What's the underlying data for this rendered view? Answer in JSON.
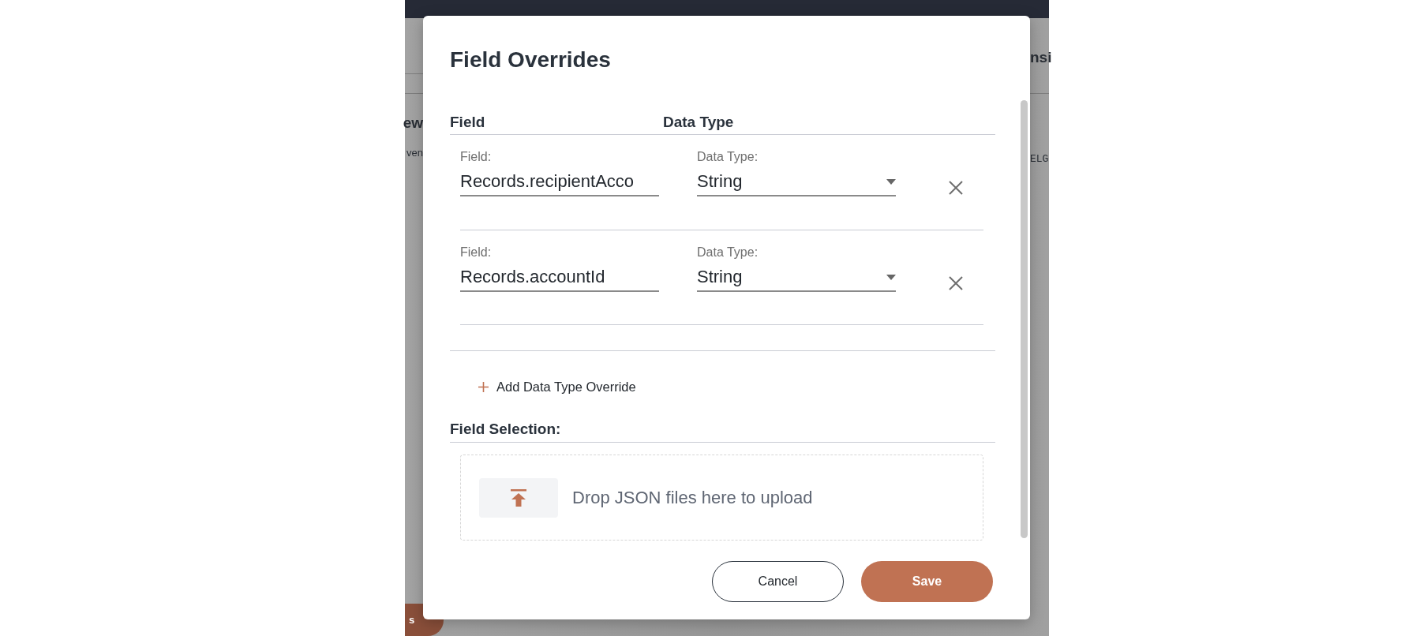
{
  "background": {
    "tab_fragment": "nsi",
    "heading_fragment": "ew",
    "text_fragment": "ven",
    "code_fragment": "ELG",
    "button_fragment": "s"
  },
  "dialog": {
    "title": "Field Overrides",
    "columns": [
      "Field",
      "Data Type"
    ],
    "rows": [
      {
        "field_label": "Field:",
        "field_value": "Records.recipientAcco",
        "type_label": "Data Type:",
        "type_value": "String"
      },
      {
        "field_label": "Field:",
        "field_value": "Records.accountId",
        "type_label": "Data Type:",
        "type_value": "String"
      }
    ],
    "add_button": "Add Data Type Override",
    "section_title": "Field Selection:",
    "dropzone_text": "Drop JSON files here to upload",
    "buttons": {
      "cancel": "Cancel",
      "save": "Save"
    }
  }
}
